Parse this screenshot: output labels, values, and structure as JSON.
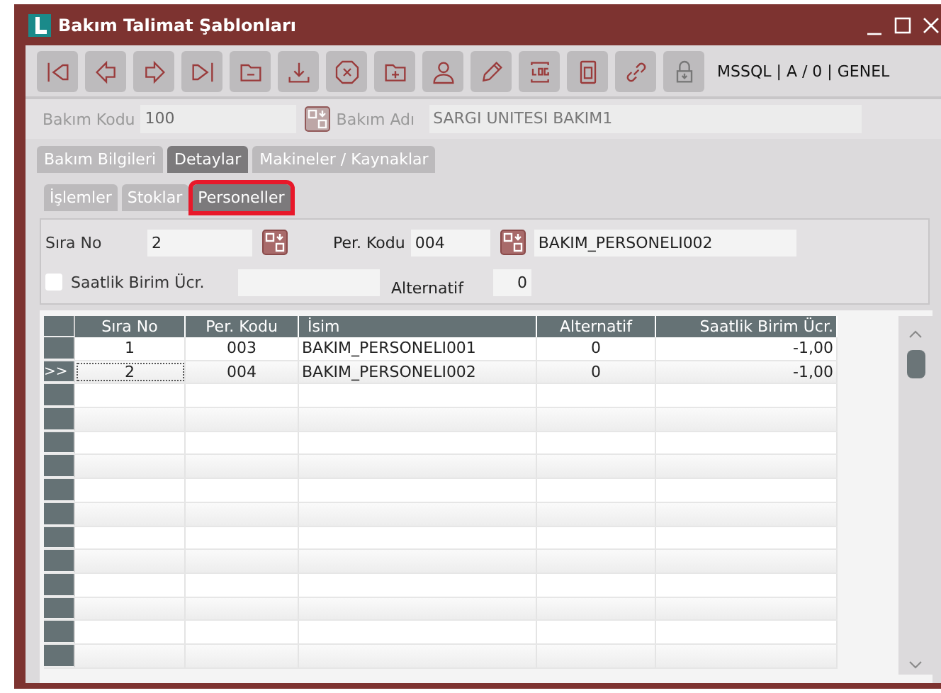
{
  "window": {
    "title": "Bakım Talimat Şablonları"
  },
  "toolbar": {
    "connection": "MSSQL | A / 0 | GENEL"
  },
  "header": {
    "code_label": "Bakım Kodu",
    "code_value": "100",
    "name_label": "Bakım Adı",
    "name_value": "SARGI UNITESI BAKIM1"
  },
  "tabs": [
    {
      "label": "Bakım Bilgileri",
      "selected": false
    },
    {
      "label": "Detaylar",
      "selected": true
    },
    {
      "label": "Makineler / Kaynaklar",
      "selected": false
    }
  ],
  "subtabs": [
    {
      "label": "İşlemler",
      "selected": false,
      "highlighted": false
    },
    {
      "label": "Stoklar",
      "selected": false,
      "highlighted": false
    },
    {
      "label": "Personeller",
      "selected": true,
      "highlighted": true
    }
  ],
  "form": {
    "sira_label": "Sıra No",
    "sira_value": "2",
    "per_label": "Per. Kodu",
    "per_value": "004",
    "per_name": "BAKIM_PERSONELI002",
    "rate_label": "Saatlik Birim Ücr.",
    "rate_checked": false,
    "alt_label": "Alternatif",
    "alt_value": "0"
  },
  "table": {
    "columns": [
      "Sıra No",
      "Per. Kodu",
      "İsim",
      "Alternatif",
      "Saatlik Birim Ücr."
    ],
    "rows": [
      {
        "cells": [
          "1",
          "003",
          "BAKIM_PERSONELI001",
          "0",
          "-1,00"
        ],
        "selected": false
      },
      {
        "cells": [
          "2",
          "004",
          "BAKIM_PERSONELI002",
          "0",
          "-1,00"
        ],
        "selected": true
      }
    ],
    "current_row_marker": ">>"
  }
}
